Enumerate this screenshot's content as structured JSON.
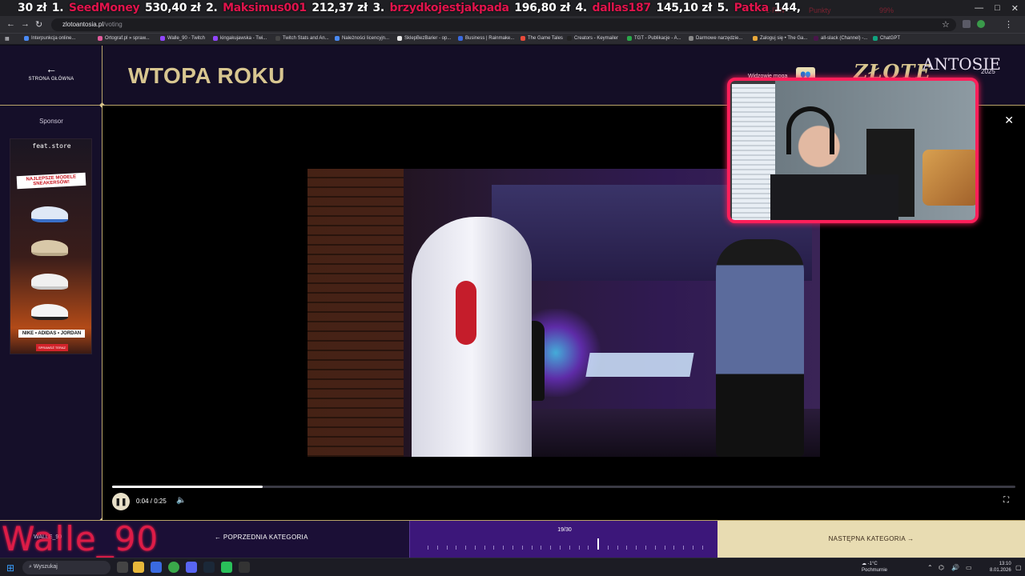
{
  "ticker": {
    "items": [
      {
        "prefix": "30 zł",
        "rank": "1.",
        "nick": "SeedMoney",
        "amount": "530,40 zł"
      },
      {
        "prefix": "",
        "rank": "2.",
        "nick": "Maksimus001",
        "amount": "212,37 zł"
      },
      {
        "prefix": "",
        "rank": "3.",
        "nick": "brzydkojestjakpada",
        "amount": "196,80 zł"
      },
      {
        "prefix": "",
        "rank": "4.",
        "nick": "dallas187",
        "amount": "145,10 zł"
      },
      {
        "prefix": "",
        "rank": "5.",
        "nick": "Patka",
        "amount": "144,"
      }
    ]
  },
  "browser": {
    "url_domain": "zlotoantosia.pl",
    "url_path": "/voting",
    "window_controls": [
      "—",
      "□",
      "✕"
    ],
    "bookmarks": [
      "Interpunkcja online...",
      "Ortograf.pl » spraw...",
      "Walle_90 - Twitch",
      "kingakujawska - Twi...",
      "Twitch Stats and An...",
      "Należności licencyjn...",
      "SklepBezBarier - op...",
      "Business | Rainmake...",
      "The Game Tales",
      "Creators - Keymailer",
      "TGT - Publikacje - A...",
      "Darmowe narzędzie...",
      "Zaloguj się • The Ga...",
      "all-slack (Channel) -...",
      "ChatGPT"
    ]
  },
  "sidebar": {
    "back_label": "STRONA GŁÓWNA",
    "sponsor_label": "Sponsor",
    "ad": {
      "brand": "feat.store",
      "headline": "NAJLEPSZE MODELE SNEAKERSÓW!",
      "brands": "NIKE • ADIDAS • JORDAN",
      "cta": "SPRAWDŹ TERAZ"
    }
  },
  "header": {
    "title": "WTOPA ROKU",
    "watch_label": "Widzowie mogą",
    "logo_main": "ZŁOTE",
    "logo_sub": "ANTOSIE",
    "logo_year": "2025"
  },
  "player": {
    "time": "0:04 / 0:25",
    "progress": 0.167
  },
  "bottom": {
    "streamer_overlay": "Walle_90",
    "streamer_small": "WALLE_90",
    "prev_label": "POPRZEDNIA KATEGORIA",
    "counter": "19/30",
    "current_index": 19,
    "total": 30,
    "next_label": "NASTĘPNA KATEGORIA"
  },
  "taskbar": {
    "search_placeholder": "Wyszukaj",
    "weather_temp": "-1°C",
    "weather_desc": "Pochmurnie",
    "time": "13:10",
    "date": "8.01.2026"
  },
  "colors": {
    "gold": "#d8c690",
    "accent_pink": "#ff1f5a",
    "purple_bar": "#3c177a",
    "page_bg": "#140e26"
  }
}
